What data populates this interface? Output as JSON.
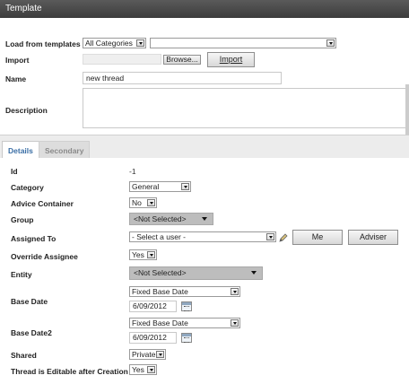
{
  "window": {
    "title": "Template"
  },
  "form": {
    "load_templates_label": "Load from templates",
    "load_category_value": "All Categories",
    "load_template_value": "",
    "import_label": "Import",
    "import_file_value": "",
    "browse_button": "Browse...",
    "import_button": "Import",
    "name_label": "Name",
    "name_value": "new thread",
    "description_label": "Description",
    "description_value": ""
  },
  "tabs": {
    "details": "Details",
    "secondary": "Secondary"
  },
  "details": {
    "id_label": "Id",
    "id_value": "-1",
    "category_label": "Category",
    "category_value": "General",
    "advice_label": "Advice Container",
    "advice_value": "No",
    "group_label": "Group",
    "group_value": "<Not Selected>",
    "assigned_label": "Assigned To",
    "assigned_value": "- Select a user -",
    "me_button": "Me",
    "adviser_button": "Adviser",
    "override_label": "Override Assignee",
    "override_value": "Yes",
    "entity_label": "Entity",
    "entity_value": "<Not Selected>",
    "base_date_label": "Base Date",
    "base_date_type": "Fixed Base Date",
    "base_date_value": "6/09/2012",
    "base_date2_label": "Base Date2",
    "base_date2_type": "Fixed Base Date",
    "base_date2_value": "6/09/2012",
    "shared_label": "Shared",
    "shared_value": "Private",
    "editable_label": "Thread is Editable after Creation",
    "editable_value": "Yes"
  }
}
